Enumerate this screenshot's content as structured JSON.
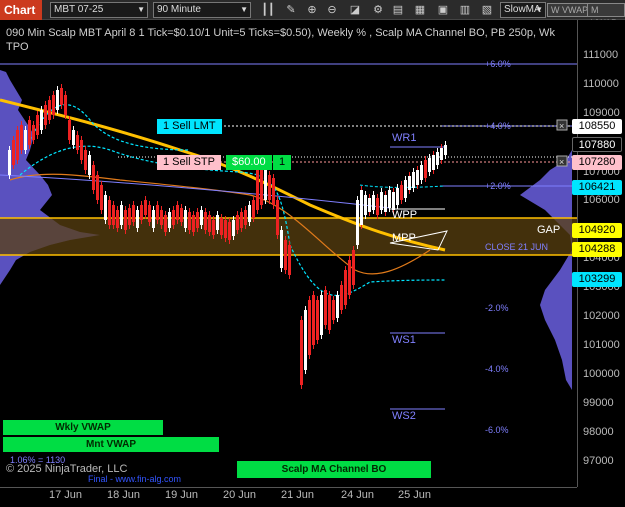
{
  "toolbar": {
    "tab_label": "Chart",
    "instrument": "MBT 07-25",
    "interval": "90 Minute",
    "indicator_select": "SlowMA",
    "buttons": [
      "W VWAP",
      "M VWAP"
    ]
  },
  "header": {
    "title": "090 Min Scalp MBT April 8 1 Tick=$0.10/1 Unit=5 Ticks=$0.50), Weekly % , Scalp MA Channel BO, PB 250p, Wk",
    "subtitle": "TPO"
  },
  "price_axis": {
    "ticks": [
      "111000",
      "110000",
      "109000",
      "107000",
      "106000",
      "104000",
      "103000",
      "102000",
      "101000",
      "100000",
      "99000",
      "98000",
      "97000"
    ]
  },
  "price_tags": [
    {
      "value": "108550",
      "bg": "#ffffff",
      "fg": "#000000"
    },
    {
      "value": "107880",
      "bg": "#000000",
      "fg": "#ffffff"
    },
    {
      "value": "107280",
      "bg": "#ffc0cb",
      "fg": "#000000"
    },
    {
      "value": "106421",
      "bg": "#00e5ff",
      "fg": "#000000"
    },
    {
      "value": "104920",
      "bg": "#ffff00",
      "fg": "#000000"
    },
    {
      "value": "104288",
      "bg": "#ffff00",
      "fg": "#000000"
    },
    {
      "value": "103299",
      "bg": "#00e5ff",
      "fg": "#000000"
    }
  ],
  "orders": {
    "sell_lmt": "1 Sell LMT",
    "sell_stp": "1 Sell STP",
    "pnl": "$60.00",
    "qty": "1"
  },
  "levels": {
    "wr1": "WR1",
    "wpp": "WPP",
    "mpp": "MPP",
    "ws1": "WS1",
    "ws2": "WS2",
    "gap": "GAP",
    "close": "CLOSE 21 JUN"
  },
  "percents": [
    "+6.0%",
    "+4.0%",
    "+2.0%",
    "-2.0%",
    "-4.0%",
    "-6.0%"
  ],
  "time_axis": [
    "17 Jun",
    "18 Jun",
    "19 Jun",
    "20 Jun",
    "21 Jun",
    "24 Jun",
    "25 Jun"
  ],
  "footer": {
    "wkly_vwap": "Wkly VWAP",
    "mnt_vwap": "Mnt VWAP",
    "ratio": "1.06% = 1130",
    "copyright": "© 2025 NinjaTrader, LLC",
    "scalp": "Scalp MA Channel BO",
    "final": "Final - www.fin-alg.com"
  },
  "colors": {
    "accent": "#cc3a1e",
    "pivot": "#8080ff",
    "cyan": "#00e5ff",
    "gold": "#ffc000"
  }
}
